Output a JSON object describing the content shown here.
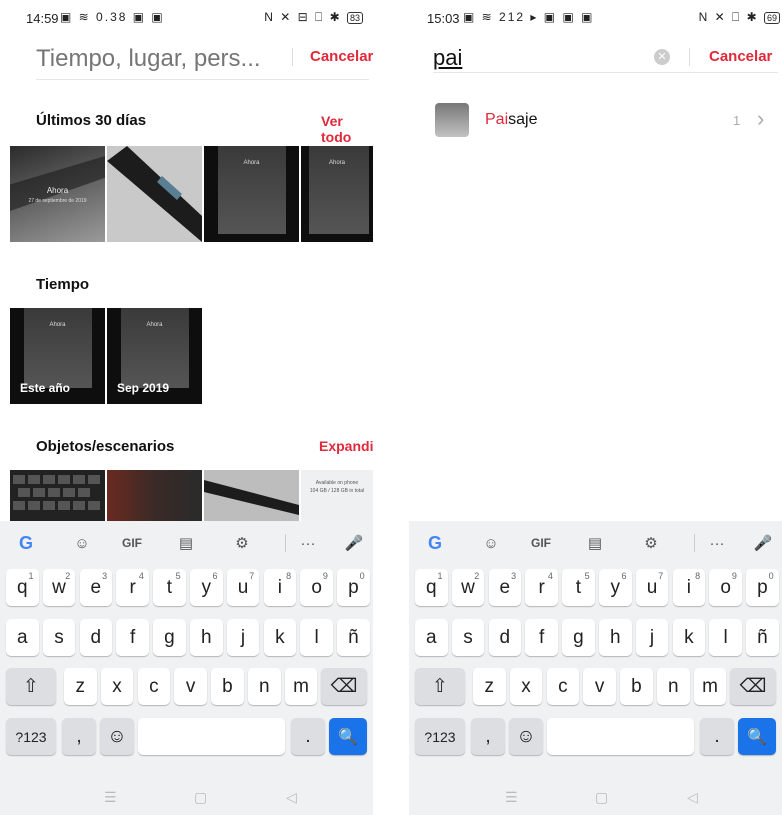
{
  "left": {
    "status": {
      "time": "14:59",
      "icons": "▣ ≋ 0.38 ▣ ▣",
      "right_icons": "N ✕ ⊟ ⎕ ✱",
      "battery": "83"
    },
    "search": {
      "placeholder": "Tiempo, lugar, pers...",
      "cancel": "Cancelar"
    },
    "recent": {
      "title": "Últimos 30 días",
      "link": "Ver todo",
      "photo_caption": "Ahora",
      "photo_date": "27 de septiembre de 2019"
    },
    "time": {
      "title": "Tiempo",
      "items": [
        {
          "label": "Este año"
        },
        {
          "label": "Sep 2019"
        }
      ]
    },
    "objects": {
      "title": "Objetos/escenarios",
      "link": "Expandir",
      "doc_line1": "Available on phone",
      "doc_line2": "104 GB / 128 GB in total"
    }
  },
  "right": {
    "status": {
      "time": "15:03",
      "icons": "▣ ≋ 212 ▸ ▣ ▣ ▣",
      "right_icons": "N ✕ ⎕ ✱",
      "battery": "69"
    },
    "search": {
      "value": "pai",
      "cancel": "Cancelar"
    },
    "result": {
      "highlight": "Pai",
      "rest": "saje",
      "count": "1",
      "chevron": "›"
    }
  },
  "keyboard": {
    "toolbar": [
      "G",
      "☺",
      "GIF",
      "▤",
      "⚙",
      "···",
      "🎤"
    ],
    "row1": [
      {
        "k": "q",
        "n": "1"
      },
      {
        "k": "w",
        "n": "2"
      },
      {
        "k": "e",
        "n": "3"
      },
      {
        "k": "r",
        "n": "4"
      },
      {
        "k": "t",
        "n": "5"
      },
      {
        "k": "y",
        "n": "6"
      },
      {
        "k": "u",
        "n": "7"
      },
      {
        "k": "i",
        "n": "8"
      },
      {
        "k": "o",
        "n": "9"
      },
      {
        "k": "p",
        "n": "0"
      }
    ],
    "row2": [
      "a",
      "s",
      "d",
      "f",
      "g",
      "h",
      "j",
      "k",
      "l",
      "ñ"
    ],
    "row3": [
      "z",
      "x",
      "c",
      "v",
      "b",
      "n",
      "m"
    ],
    "shift": "⇧",
    "backspace": "⌫",
    "symbols": "?123",
    "comma": ",",
    "emoji": "☺",
    "period": ".",
    "search": "🔍"
  },
  "nav": {
    "menu": "☰",
    "home": "▢",
    "back": "◁"
  },
  "colors": {
    "accent": "#e0293a",
    "key_blue": "#1a73e8",
    "google_blue": "#4285f4",
    "google_red": "#ea4335"
  }
}
